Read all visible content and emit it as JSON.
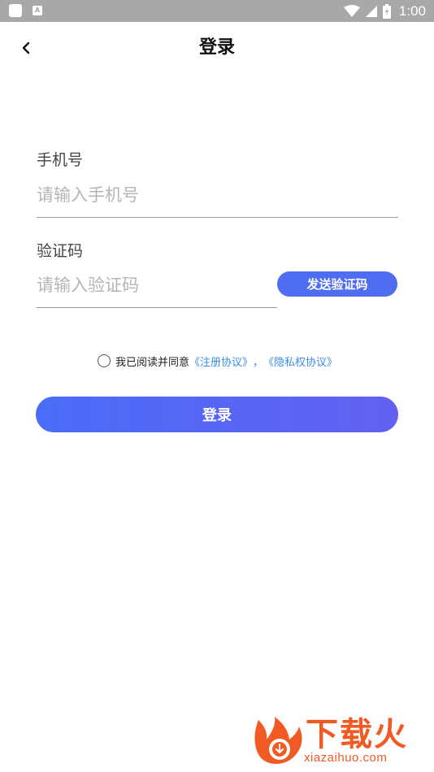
{
  "status_bar": {
    "time": "1:00",
    "notification_icon": "A"
  },
  "header": {
    "back_icon": "chevron-left-icon",
    "title": "登录"
  },
  "phone": {
    "label": "手机号",
    "placeholder": "请输入手机号",
    "value": ""
  },
  "code": {
    "label": "验证码",
    "placeholder": "请输入验证码",
    "value": "",
    "send_button": "发送验证码"
  },
  "agreement": {
    "checked": false,
    "prefix": "我已阅读并同意",
    "link_register": "《注册协议》",
    "separator": "，",
    "link_privacy": "《隐私权协议》"
  },
  "login_button": "登录",
  "watermark": {
    "brand": "下载火",
    "url": "xiazaihuo.com"
  },
  "colors": {
    "accent": "#4f6df0",
    "link": "#3a8ee6",
    "watermark": "#f15a22"
  }
}
